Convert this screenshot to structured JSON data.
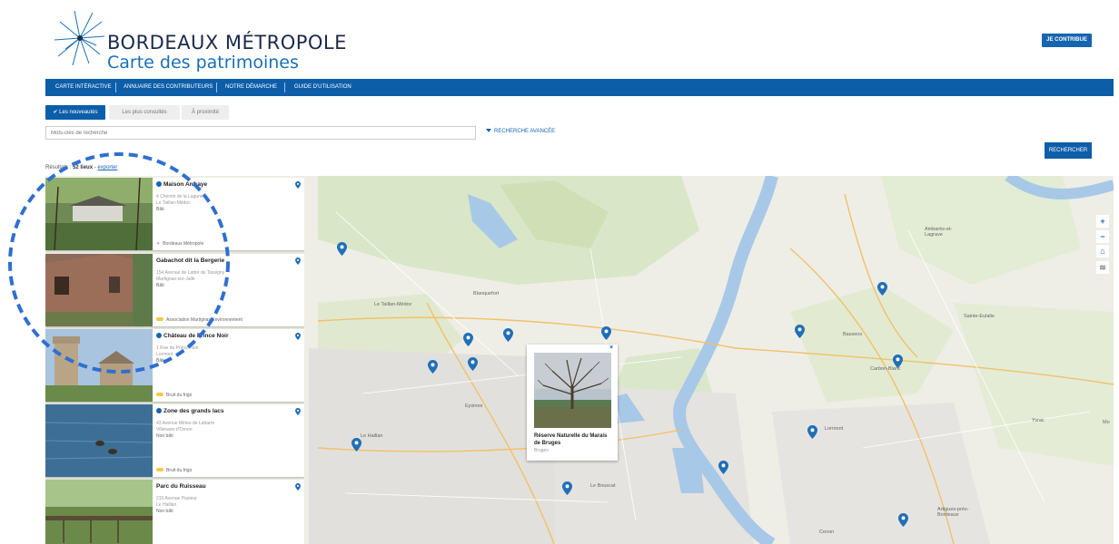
{
  "header": {
    "logo_title": "BORDEAUX MÉTROPOLE",
    "logo_subtitle": "Carte des patrimoines",
    "contribute_label": "JE CONTRIBUE"
  },
  "nav": {
    "items": [
      "CARTE INTÉRACTIVE",
      "ANNUAIRE DES CONTRIBUTEURS",
      "NOTRE DÉMARCHE",
      "GUIDE D'UTILISATION"
    ]
  },
  "tabs": {
    "new_label": "Les nouveautés",
    "popular_label": "Les plus consultés",
    "nearby_label": "À proximité"
  },
  "search": {
    "placeholder": "Mots-clés de recherche",
    "advanced_label": "RECHERCHE AVANCÉE",
    "button_label": "RECHERCHER"
  },
  "results": {
    "prefix": "Résultats :",
    "count": "52 lieux",
    "separator": "-",
    "export_label": "exporter"
  },
  "cards": [
    {
      "title": "Maison Anfraye",
      "verified": true,
      "address": "4 Chemin de la Lagune",
      "city": "Le Taillan-Médoc",
      "type": "Bâti",
      "org": "Bordeaux Métropole"
    },
    {
      "title": "Gabachot dit la Bergerie",
      "verified": false,
      "address": "154 Avenue de Lattre de Tassigny",
      "city": "Martignas-sur-Jalle",
      "type": "Bâti",
      "org": "Association Martignas Environnement"
    },
    {
      "title": "Château de Prince Noir",
      "verified": true,
      "address": "1 Rue du Prince Noir",
      "city": "Lormont",
      "type": "Bâti",
      "org": "Bruit du frigo"
    },
    {
      "title": "Zone des grands lacs",
      "verified": true,
      "address": "43 Avenue Mirieu de Labarre",
      "city": "Villenave-d'Ornon",
      "type": "Non bâti",
      "org": "Bruit du frigo"
    },
    {
      "title": "Parc du Ruisseau",
      "verified": false,
      "address": "215 Avenue Pasteur",
      "city": "Le Haillan",
      "type": "Non bâti",
      "org": ""
    }
  ],
  "popup": {
    "title": "Réserve Naturelle du Marais de Bruges",
    "city": "Bruges",
    "close_label": "×"
  },
  "map_controls": [
    "+",
    "−",
    "⌂",
    "≋"
  ],
  "map_labels": {
    "blanquefort": "Blanquefort",
    "taillan": "Le Taillan-Médoc",
    "eysines": "Eysines",
    "haillan": "Le Haillan",
    "bouscat": "Le Bouscat",
    "lormont": "Lormont",
    "carbon_blanc": "Carbon-Blanc",
    "bassens": "Bassens",
    "ambares": "Ambarès-et-Lagrave",
    "sainte_eulalie": "Sainte-Eulalie",
    "yvrac": "Yvrac",
    "artigues": "Artigues-près-Bordeaux",
    "cenon": "Cenon",
    "mo": "Mo"
  },
  "colors": {
    "brand_blue": "#0d5ea8",
    "pin_blue": "#1f6fb8",
    "river": "#a8c8e8",
    "org_yellow": "#f3c94a"
  }
}
